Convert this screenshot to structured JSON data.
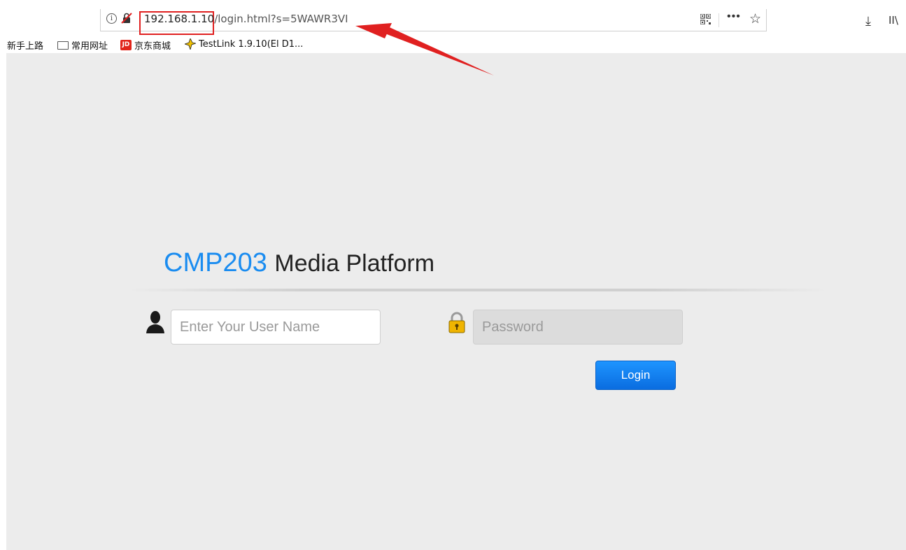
{
  "browser": {
    "url_host": "192.168.1.10",
    "url_path": "/login.html?s=5WAWR3VI",
    "bookmarks": [
      {
        "label": "新手上路",
        "icon": "none"
      },
      {
        "label": "常用网址",
        "icon": "folder-icon"
      },
      {
        "label": "京东商城",
        "icon": "jd-icon",
        "icon_text": "JD"
      },
      {
        "label": "TestLink 1.9.10(El D1...",
        "icon": "testlink-icon"
      }
    ],
    "icons": [
      "info-icon",
      "insecure-lock-icon",
      "qr-code-icon",
      "more-icon",
      "star-icon",
      "download-icon",
      "library-icon"
    ]
  },
  "page": {
    "title_brand": "CMP203",
    "title_rest": "Media Platform",
    "username_placeholder": "Enter Your User Name",
    "password_placeholder": "Password",
    "login_label": "Login"
  },
  "colors": {
    "brand": "#1a8cf0",
    "button": "#0a7ef0",
    "annotation": "#e02020",
    "page_bg": "#ececec"
  }
}
